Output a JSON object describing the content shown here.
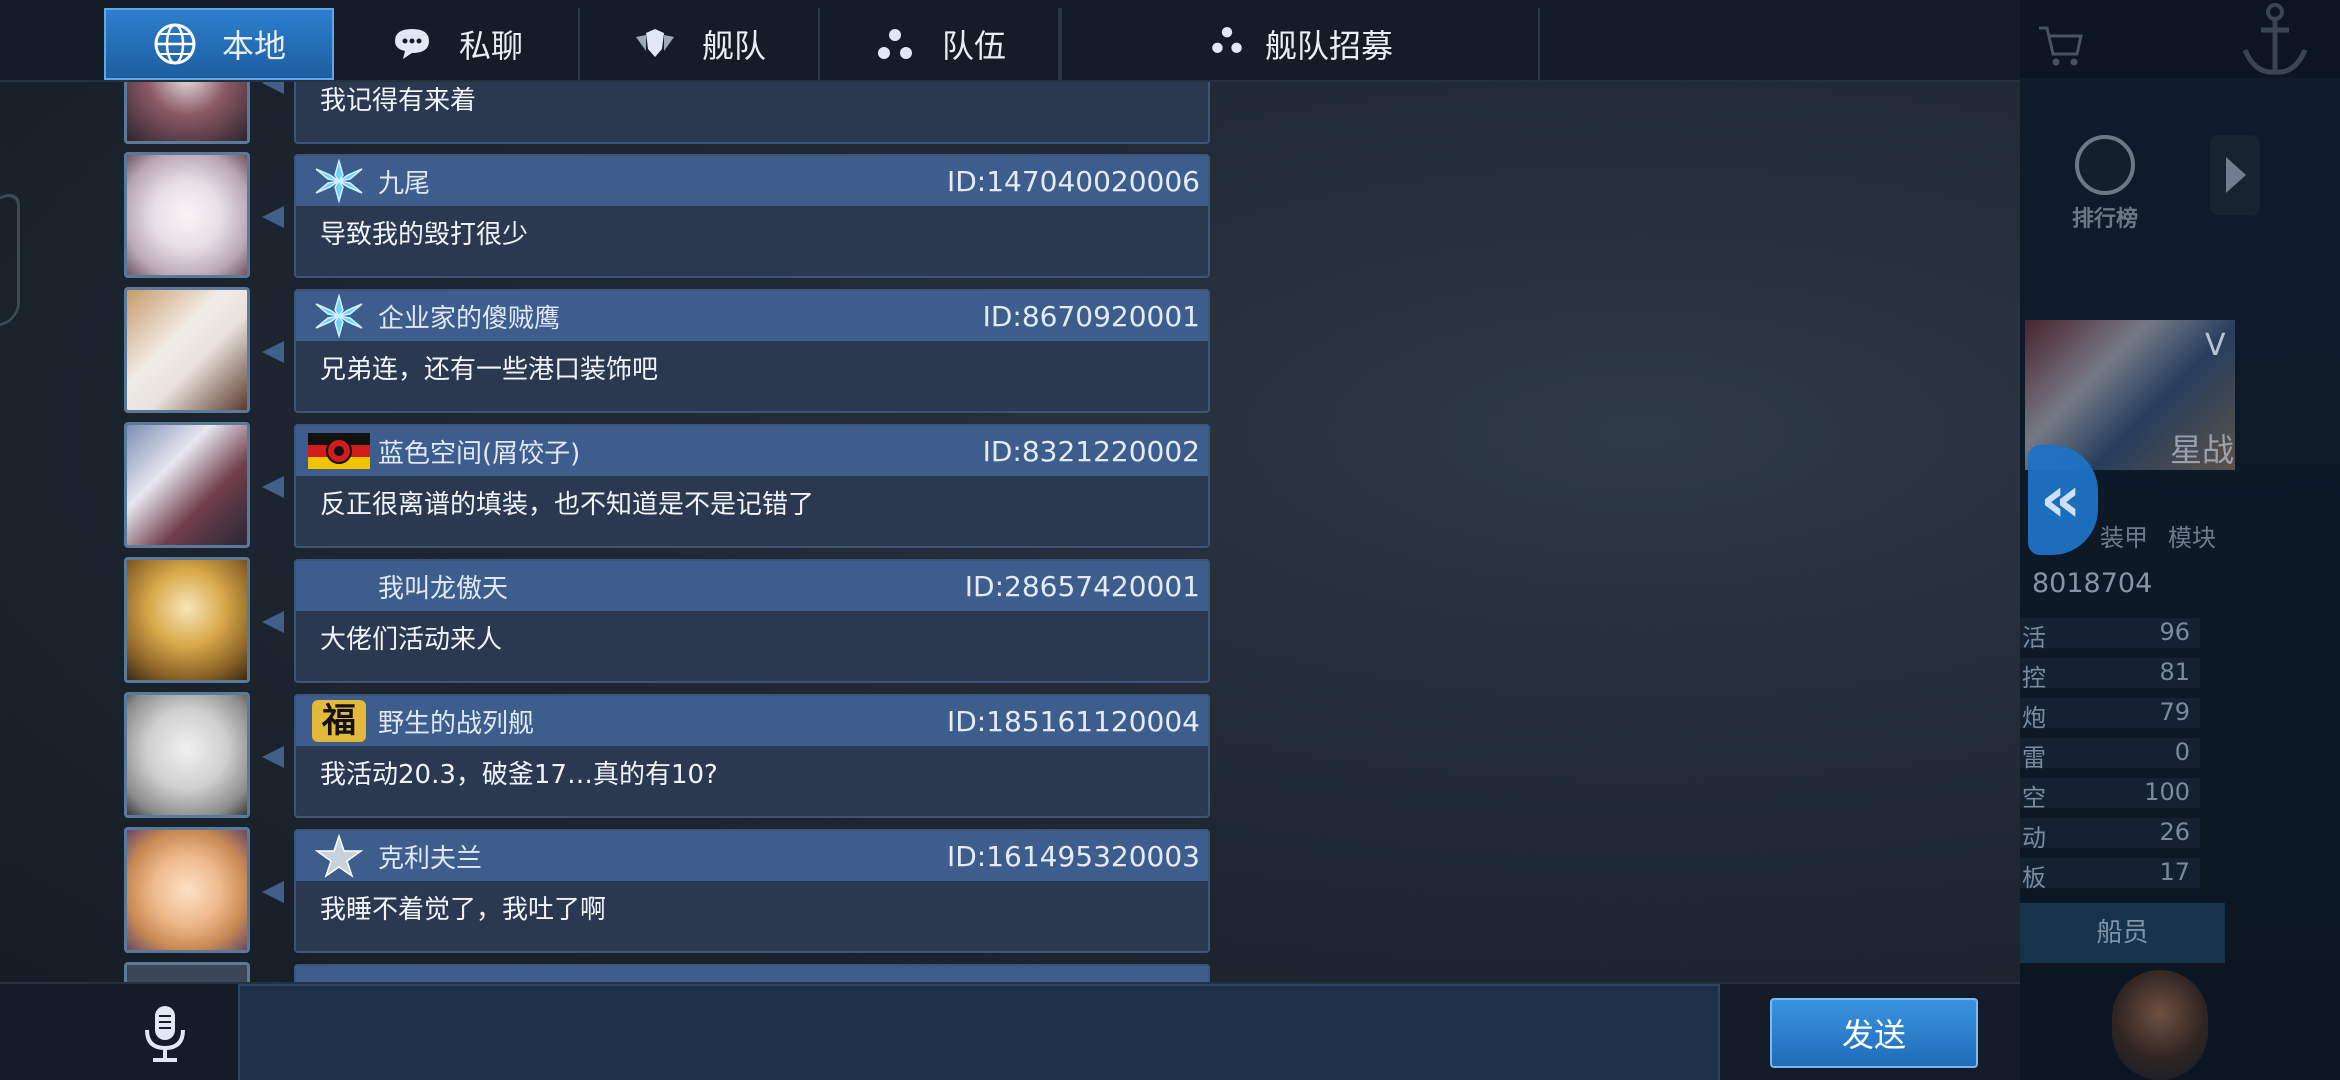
{
  "tabs": [
    {
      "label": "本地",
      "icon": "globe-icon",
      "active": true
    },
    {
      "label": "私聊",
      "icon": "chat-bubble-icon",
      "active": false
    },
    {
      "label": "舰队",
      "icon": "shield-wings-icon",
      "active": false
    },
    {
      "label": "队伍",
      "icon": "dots-triangle-icon",
      "active": false
    }
  ],
  "recruit_tab": {
    "label": "舰队招募",
    "icon": "dots-triangle-icon"
  },
  "messages": [
    {
      "badge": "",
      "name": "",
      "id": "",
      "text": "我记得有来着",
      "avatar_color": "#6a4f58"
    },
    {
      "badge": "snowflake-badge",
      "name": "九尾",
      "id": "ID:147040020006",
      "text": "导致我的毁打很少",
      "avatar_color": "#d9d4dc"
    },
    {
      "badge": "snowflake-badge",
      "name": "企业家的傻贼鹰",
      "id": "ID:8670920001",
      "text": "兄弟连，还有一些港口装饰吧",
      "avatar_color": "#b07a52"
    },
    {
      "badge": "german-flag-badge",
      "name": "蓝色空间(屑饺子)",
      "id": "ID:8321220002",
      "text": "反正很离谱的填装，也不知道是不是记错了",
      "avatar_color": "#5a5f80"
    },
    {
      "badge": "",
      "name": "我叫龙傲天",
      "id": "ID:28657420001",
      "text": "大佬们活动来人",
      "avatar_color": "#c59a48"
    },
    {
      "badge": "fu-character-badge",
      "badge_text": "福",
      "name": "野生的战列舰",
      "id": "ID:185161120004",
      "text": "我活动20.3，破釜17…真的有10?",
      "avatar_color": "#c8c8c8"
    },
    {
      "badge": "star-badge",
      "name": "克利夫兰",
      "id": "ID:161495320003",
      "text": "我睡不着觉了，我吐了啊",
      "avatar_color": "#e6b890"
    }
  ],
  "input": {
    "placeholder": ""
  },
  "send_button": "发送",
  "background_panel": {
    "rank_label": "排行榜",
    "ship_grade": "V",
    "ship_name": "星战",
    "armor_label": "装甲",
    "module_label": "模块",
    "score": "8018704",
    "stats": [
      {
        "label": "活",
        "value": "96"
      },
      {
        "label": "控",
        "value": "81"
      },
      {
        "label": "炮",
        "value": "79"
      },
      {
        "label": "雷",
        "value": "0"
      },
      {
        "label": "空",
        "value": "100"
      },
      {
        "label": "动",
        "value": "26"
      },
      {
        "label": "板",
        "value": "17"
      }
    ],
    "crew_button": "船员"
  },
  "colors": {
    "accent": "#2d7fcf",
    "header_bar": "#3d5d8c",
    "bubble": "#2a3950",
    "send": "#1f6cb8"
  }
}
